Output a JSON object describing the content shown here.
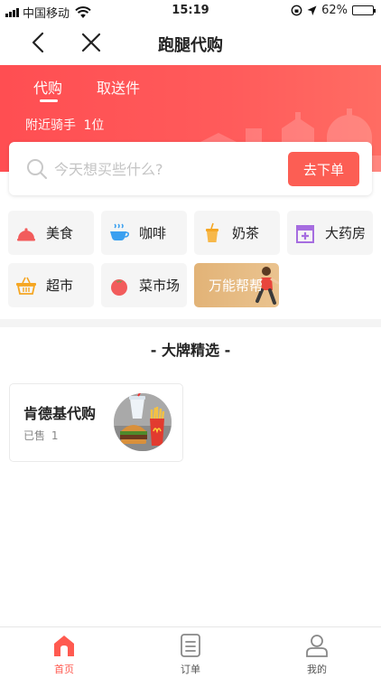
{
  "status_bar": {
    "carrier": "中国移动",
    "time": "15:19",
    "battery_text": "62%",
    "battery_level": 0.62
  },
  "nav": {
    "title": "跑腿代购"
  },
  "header": {
    "tabs": [
      {
        "label": "代购",
        "active": true
      },
      {
        "label": "取送件",
        "active": false
      }
    ],
    "riders_label": "附近骑手",
    "riders_count": "1位"
  },
  "search": {
    "placeholder": "今天想买些什么?",
    "button_label": "去下单"
  },
  "categories": [
    {
      "label": "美食",
      "icon": "cloche-icon"
    },
    {
      "label": "咖啡",
      "icon": "coffee-icon"
    },
    {
      "label": "奶茶",
      "icon": "milk-tea-icon"
    },
    {
      "label": "大药房",
      "icon": "pharmacy-icon"
    },
    {
      "label": "超市",
      "icon": "basket-icon"
    },
    {
      "label": "菜市场",
      "icon": "tomato-icon"
    },
    {
      "label": "万能帮帮",
      "icon": "runner-icon"
    }
  ],
  "section": {
    "title": "- 大牌精选 -"
  },
  "brands": [
    {
      "name": "肯德基代购",
      "sold_label": "已售",
      "sold_count": "1"
    }
  ],
  "tab_bar": [
    {
      "label": "首页",
      "active": true
    },
    {
      "label": "订单",
      "active": false
    },
    {
      "label": "我的",
      "active": false
    }
  ],
  "colors": {
    "brand_red": "#fc5e54",
    "header_gradient_start": "#ff4e52",
    "header_gradient_end": "#ff6c63",
    "special_tile": "#e2b377"
  }
}
